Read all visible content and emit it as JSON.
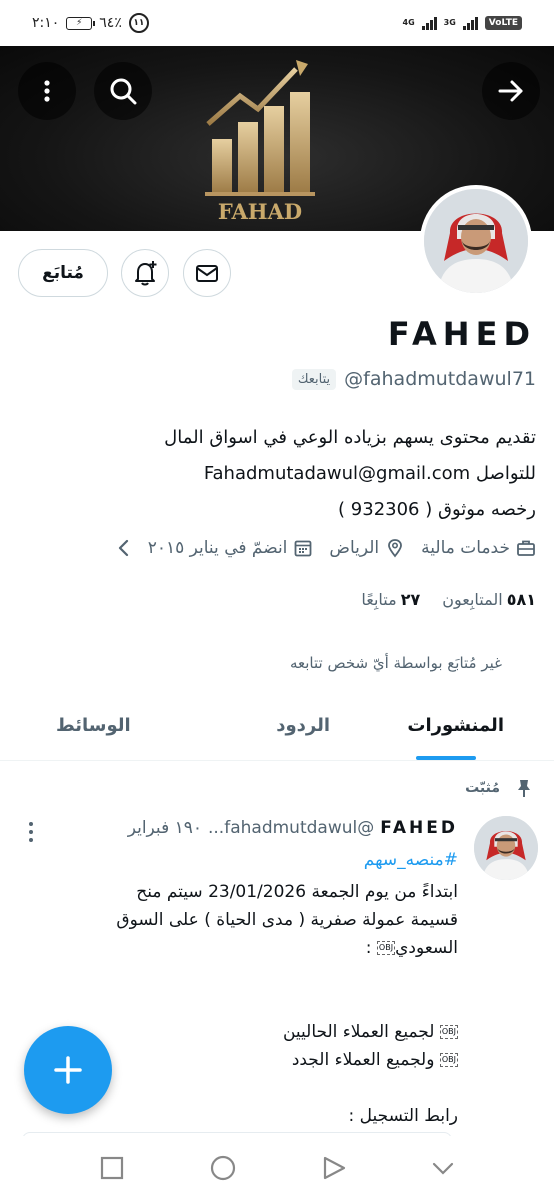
{
  "status_bar": {
    "time": "٢:١٠",
    "battery": "٦٤٪",
    "badge": "١١",
    "network1": "4G",
    "network2": "3G",
    "volte": "VoLTE"
  },
  "profile": {
    "banner_logo_text": "FAHAD",
    "name": "FAHED",
    "handle": "@fahadmutdawul71",
    "follows_you": "يتابعك",
    "follow_button": "مُتابَع",
    "bio_lines": [
      "تقديم محتوى يسهم بزياده الوعي في اسواق المال",
      "للتواصل Fahadmutadawul@gmail.com",
      "رخصه موثوق ( 932306 )"
    ],
    "category": "خدمات مالية",
    "location": "الرياض",
    "joined": "انضمّ في يناير ٢٠١٥",
    "followers_count": "٥٨١",
    "followers_label": "المتابِعون",
    "following_count": "٢٧",
    "following_label": "متابِعًا",
    "not_followed_note": "غير مُتابَع بواسطة أيّ شخص تتابعه"
  },
  "tabs": [
    {
      "label": "المنشورات",
      "active": true
    },
    {
      "label": "الردود",
      "active": false
    },
    {
      "label": "الوسائط",
      "active": false
    }
  ],
  "pinned_label": "مُثبّت",
  "post": {
    "author": "FAHED",
    "handle": "@fahadmutdawul...",
    "date": "١٩٠ فبراير",
    "hashtag": "#منصه_سهم",
    "line1": "ابتداءً من يوم الجمعة 23/01/2026 سيتم منح",
    "line2": "قسيمة عمولة صفرية ( مدى الحياة ) على السوق",
    "line3": "السعودي",
    "line3_tail": " :",
    "line4": "لجميع العملاء الحاليين",
    "line5": "ولجميع العملاء الجدد",
    "line6": "رابط التسجيل :",
    "obj_glyph": "OBJ"
  },
  "colors": {
    "accent": "#1d9bf0",
    "text": "#0f1419",
    "secondary": "#536471"
  }
}
